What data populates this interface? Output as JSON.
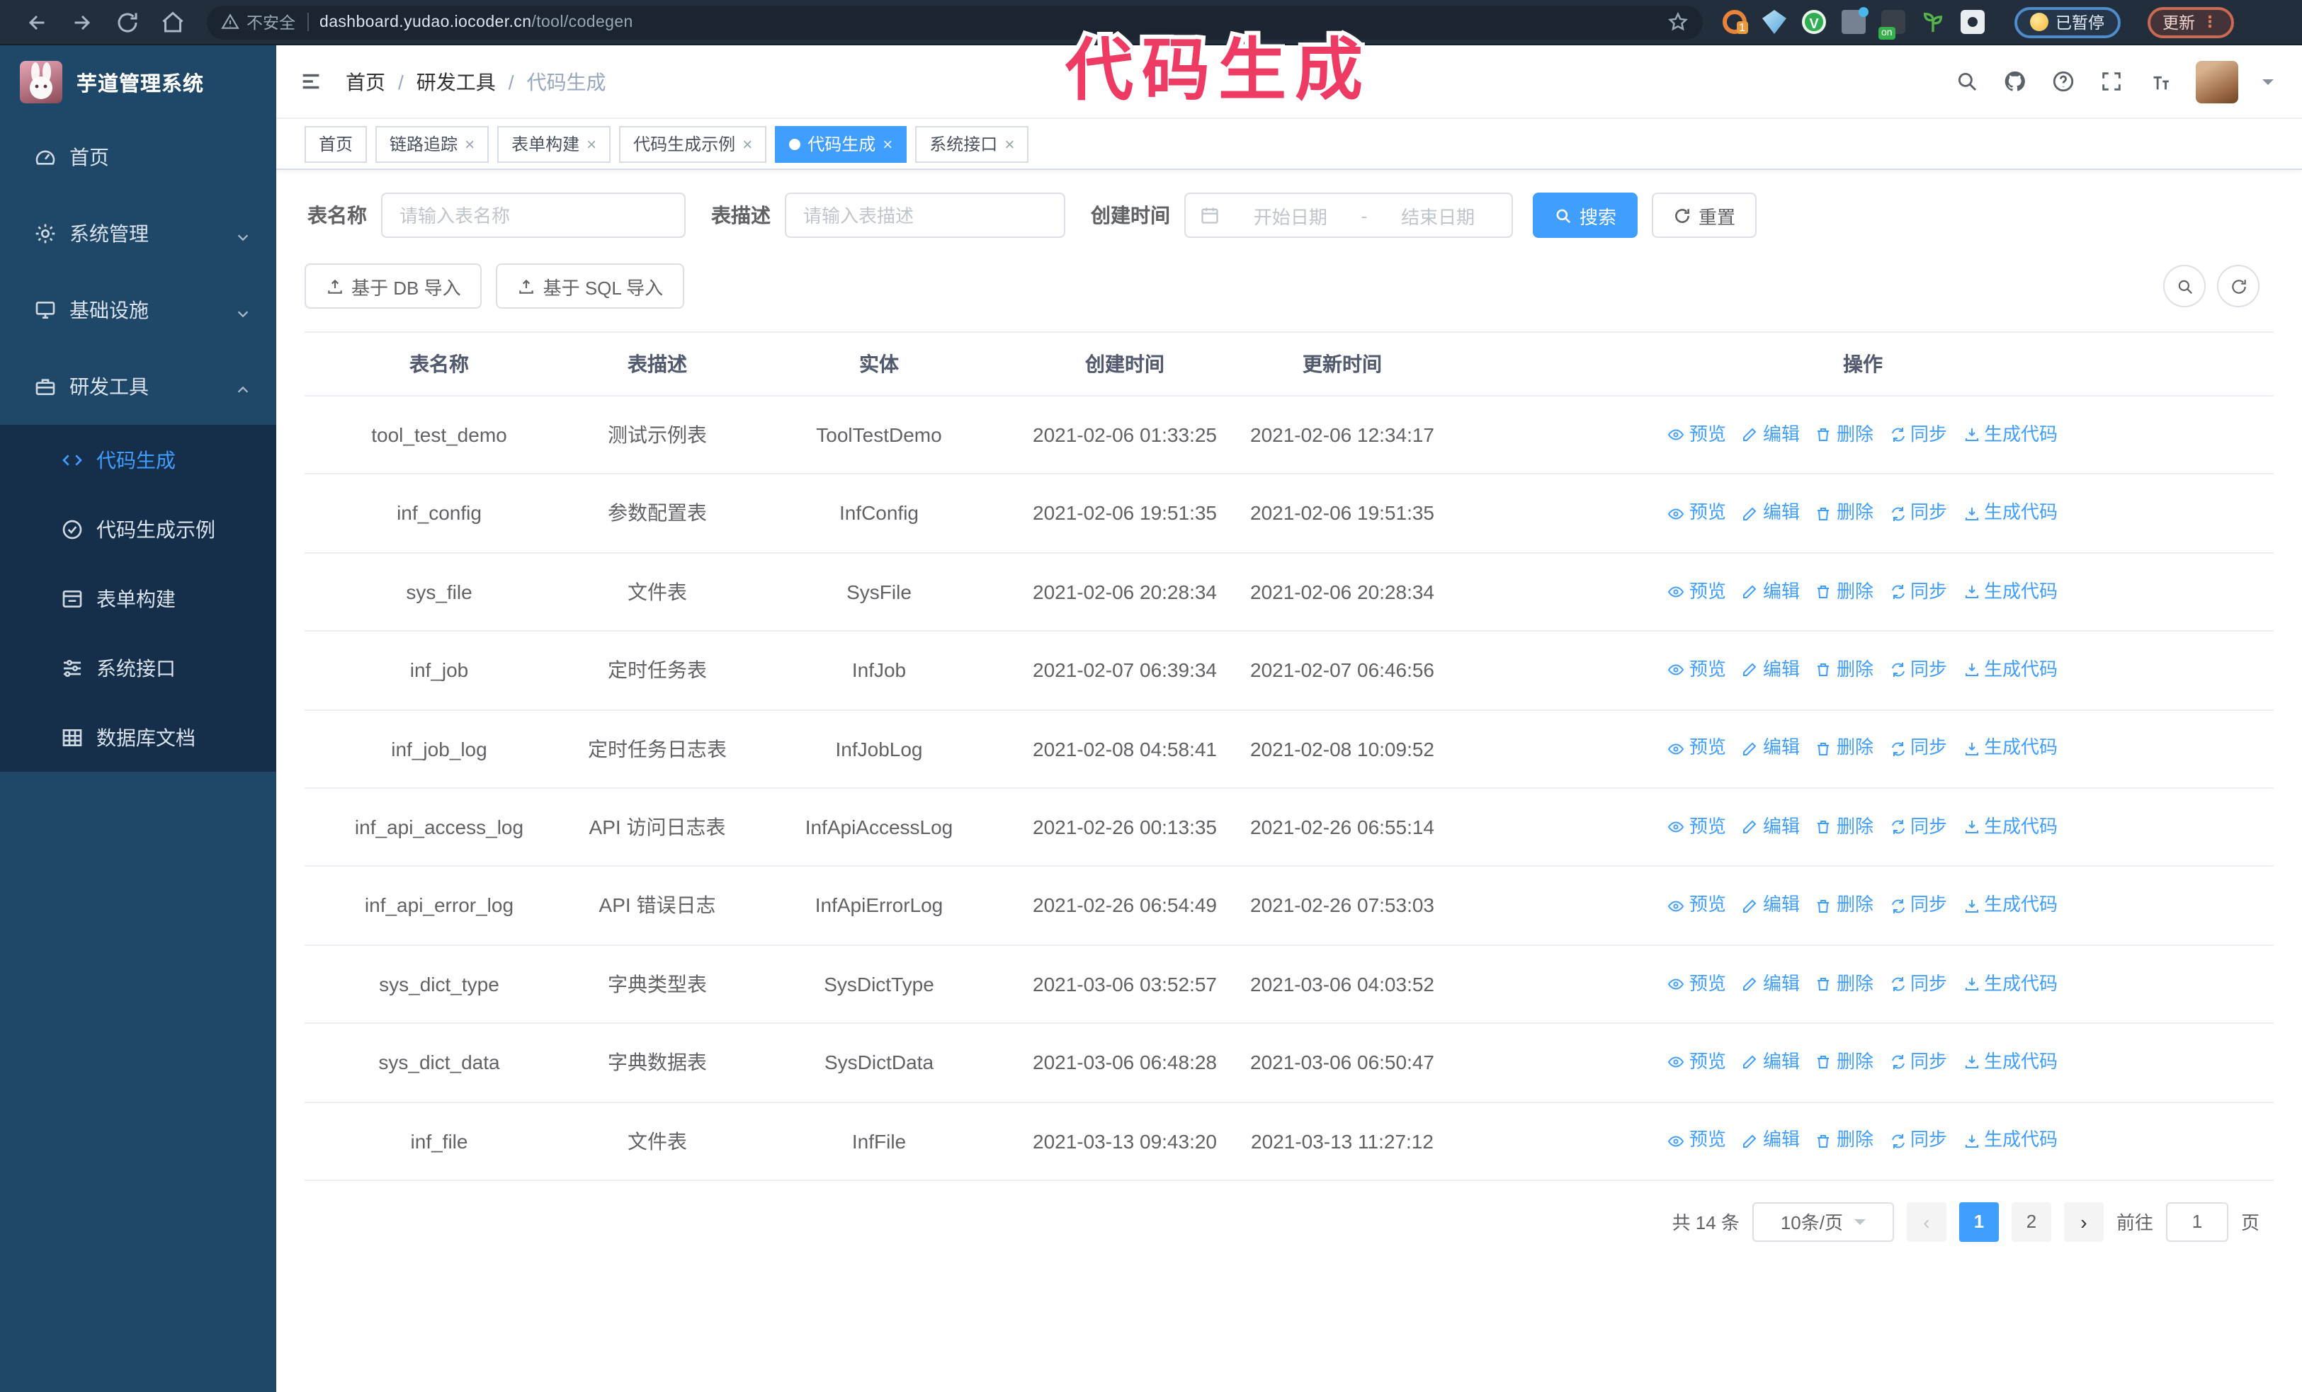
{
  "browser": {
    "security_label": "不安全",
    "url": "dashboard.yudao.iocoder.cn",
    "url_path": "/tool/codegen",
    "extension_badge": "1",
    "extension_on_badge": "on",
    "paused_chip": "已暂停",
    "update_button": "更新",
    "dots": "⋮"
  },
  "annotation": "代码生成",
  "sidebar": {
    "app_title": "芋道管理系统",
    "items": [
      {
        "label": "首页",
        "expandable": false
      },
      {
        "label": "系统管理",
        "expandable": true
      },
      {
        "label": "基础设施",
        "expandable": true
      },
      {
        "label": "研发工具",
        "expandable": true,
        "expanded": true
      }
    ],
    "sub_items": [
      {
        "label": "代码生成",
        "active": true
      },
      {
        "label": "代码生成示例",
        "active": false
      },
      {
        "label": "表单构建",
        "active": false
      },
      {
        "label": "系统接口",
        "active": false
      },
      {
        "label": "数据库文档",
        "active": false
      }
    ]
  },
  "header": {
    "breadcrumb": [
      "首页",
      "研发工具",
      "代码生成"
    ],
    "separator": "/"
  },
  "tabs": [
    {
      "label": "首页",
      "closable": false,
      "active": false
    },
    {
      "label": "链路追踪",
      "closable": true,
      "active": false
    },
    {
      "label": "表单构建",
      "closable": true,
      "active": false
    },
    {
      "label": "代码生成示例",
      "closable": true,
      "active": false
    },
    {
      "label": "代码生成",
      "closable": true,
      "active": true
    },
    {
      "label": "系统接口",
      "closable": true,
      "active": false
    }
  ],
  "filters": {
    "name_label": "表名称",
    "name_placeholder": "请输入表名称",
    "desc_label": "表描述",
    "desc_placeholder": "请输入表描述",
    "time_label": "创建时间",
    "start_placeholder": "开始日期",
    "range_separator": "-",
    "end_placeholder": "结束日期",
    "search_label": "搜索",
    "reset_label": "重置"
  },
  "toolbar": {
    "import_db_label": "基于 DB 导入",
    "import_sql_label": "基于 SQL 导入"
  },
  "table": {
    "columns": [
      "表名称",
      "表描述",
      "实体",
      "创建时间",
      "更新时间",
      "操作"
    ],
    "actions": [
      "预览",
      "编辑",
      "删除",
      "同步",
      "生成代码"
    ],
    "rows": [
      {
        "name": "tool_test_demo",
        "desc": "测试示例表",
        "entity": "ToolTestDemo",
        "created": "2021-02-06 01:33:25",
        "updated": "2021-02-06 12:34:17"
      },
      {
        "name": "inf_config",
        "desc": "参数配置表",
        "entity": "InfConfig",
        "created": "2021-02-06 19:51:35",
        "updated": "2021-02-06 19:51:35"
      },
      {
        "name": "sys_file",
        "desc": "文件表",
        "entity": "SysFile",
        "created": "2021-02-06 20:28:34",
        "updated": "2021-02-06 20:28:34"
      },
      {
        "name": "inf_job",
        "desc": "定时任务表",
        "entity": "InfJob",
        "created": "2021-02-07 06:39:34",
        "updated": "2021-02-07 06:46:56"
      },
      {
        "name": "inf_job_log",
        "desc": "定时任务日志表",
        "entity": "InfJobLog",
        "created": "2021-02-08 04:58:41",
        "updated": "2021-02-08 10:09:52"
      },
      {
        "name": "inf_api_access_log",
        "desc": "API 访问日志表",
        "entity": "InfApiAccessLog",
        "created": "2021-02-26 00:13:35",
        "updated": "2021-02-26 06:55:14"
      },
      {
        "name": "inf_api_error_log",
        "desc": "API 错误日志",
        "entity": "InfApiErrorLog",
        "created": "2021-02-26 06:54:49",
        "updated": "2021-02-26 07:53:03"
      },
      {
        "name": "sys_dict_type",
        "desc": "字典类型表",
        "entity": "SysDictType",
        "created": "2021-03-06 03:52:57",
        "updated": "2021-03-06 04:03:52"
      },
      {
        "name": "sys_dict_data",
        "desc": "字典数据表",
        "entity": "SysDictData",
        "created": "2021-03-06 06:48:28",
        "updated": "2021-03-06 06:50:47"
      },
      {
        "name": "inf_file",
        "desc": "文件表",
        "entity": "InfFile",
        "created": "2021-03-13 09:43:20",
        "updated": "2021-03-13 11:27:12"
      }
    ]
  },
  "pagination": {
    "total_label": "共 14 条",
    "page_size": "10条/页",
    "prev": "‹",
    "next": "›",
    "pages": [
      "1",
      "2"
    ],
    "active_page": "1",
    "goto_label": "前往",
    "goto_value": "1",
    "goto_suffix": "页"
  },
  "colors": {
    "accent": "#409eff",
    "sidebar_bg": "#1f4868",
    "submenu_bg": "#152e49",
    "browser_bar_bg": "#232e3d",
    "annotation_pink": "#ee3b63",
    "tab_active_bg": "#409eff",
    "table_border": "#ebeef5"
  }
}
